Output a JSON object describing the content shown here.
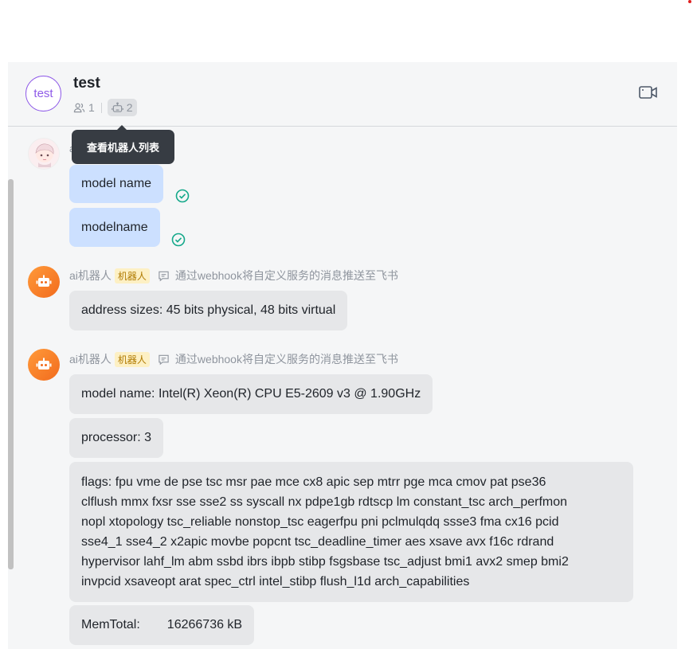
{
  "chat": {
    "title": "test",
    "avatar_text": "test",
    "member_count": "1",
    "bot_count": "2",
    "tooltip": "查看机器人列表"
  },
  "sender_hidden": "ai",
  "messages": {
    "outgoing": [
      "model name",
      "modelname"
    ],
    "bot_name": "ai机器人",
    "bot_tag": "机器人",
    "bot_source": "通过webhook将自定义服务的消息推送至飞书",
    "group1": [
      "address sizes: 45 bits physical, 48 bits virtual"
    ],
    "group2": {
      "line1": "model name: Intel(R) Xeon(R) CPU E5-2609 v3 @ 1.90GHz",
      "line2": "processor: 3",
      "flags": [
        "flags: fpu vme de pse tsc msr pae mce cx8 apic sep mtrr pge mca cmov pat pse36",
        "clflush mmx fxsr sse sse2 ss syscall nx pdpe1gb rdtscp lm constant_tsc arch_perfmon",
        "nopl xtopology tsc_reliable nonstop_tsc eagerfpu pni pclmulqdq ssse3 fma cx16 pcid",
        "sse4_1 sse4_2 x2apic movbe popcnt tsc_deadline_timer aes xsave avx f16c rdrand",
        "hypervisor lahf_lm abm ssbd ibrs ibpb stibp fsgsbase tsc_adjust bmi1 avx2 smep bmi2",
        "invpcid xsaveopt arat spec_ctrl intel_stibp flush_l1d arch_capabilities"
      ],
      "memtotal_label": "MemTotal:",
      "memtotal_value": "16266736 kB"
    }
  },
  "colors": {
    "accent_purple": "#8f5be8",
    "outgoing_bubble": "#cce0ff",
    "incoming_bubble": "#e6e7e9",
    "bot_orange": "#f26b1d",
    "check_green": "#14a88a"
  },
  "icons": [
    "members-icon",
    "robot-icon",
    "video-call-icon",
    "read-check-icon",
    "message-source-icon"
  ]
}
